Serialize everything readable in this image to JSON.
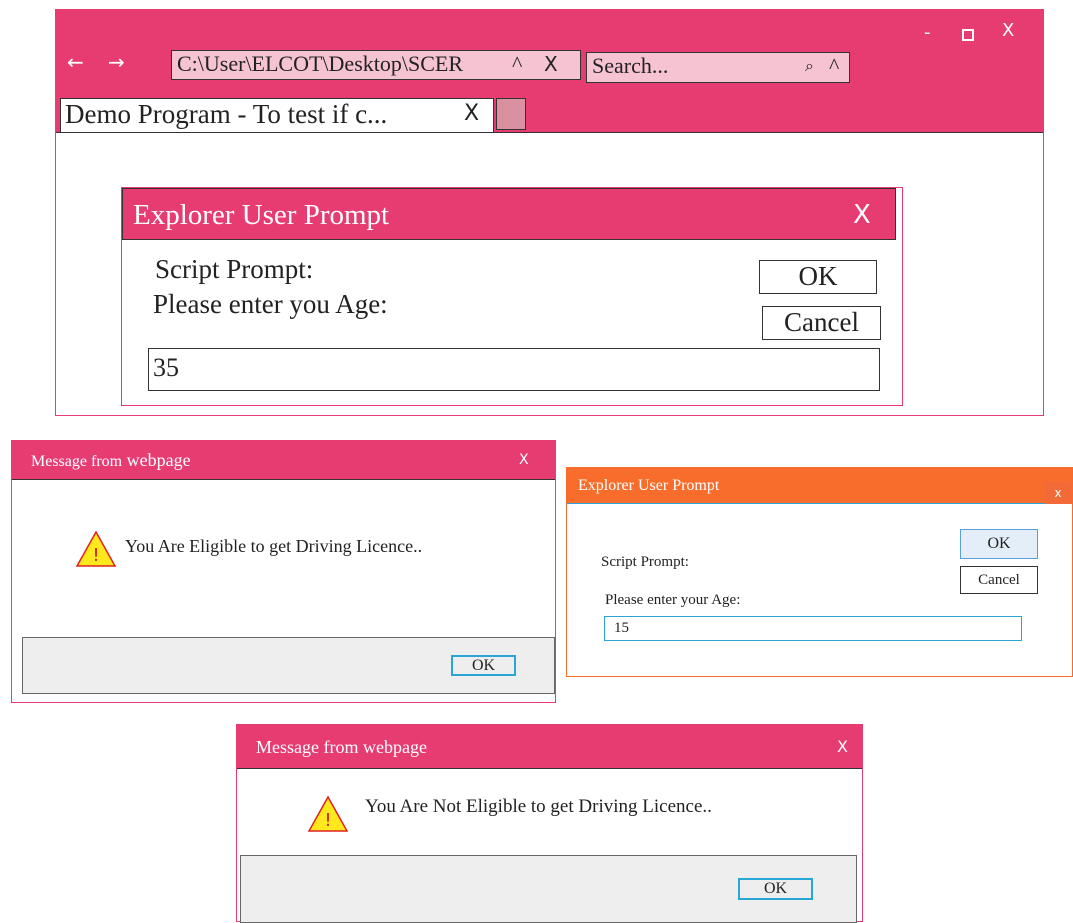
{
  "browser": {
    "window_controls": {
      "minimize": "-",
      "close": "X"
    },
    "nav": {
      "back": "←",
      "forward": "→"
    },
    "address": {
      "value": "C:\\User\\ELCOT\\Desktop\\SCER",
      "dropdown": "^",
      "clear": "X"
    },
    "search": {
      "placeholder": "Search...",
      "icon": "⌕",
      "dropdown": "^"
    },
    "tab": {
      "label": "Demo Program - To test if c...",
      "close": "X"
    },
    "colors": {
      "accent": "#e73c72",
      "address_bg": "#f6c3d3",
      "new_tab": "#d9919f"
    }
  },
  "prompt_main": {
    "title": "Explorer User Prompt",
    "close": "X",
    "script_label": "Script Prompt:",
    "question": "Please enter you Age:",
    "ok": "OK",
    "cancel": "Cancel",
    "value": "35"
  },
  "message_eligible": {
    "title_prefix": "Message from",
    "title_suffix": " webpage",
    "close": "X",
    "icon": "warning-icon",
    "icon_glyph": "!",
    "text": "You Are Eligible to get Driving Licence..",
    "ok": "OK"
  },
  "prompt_second": {
    "title": "Explorer User Prompt",
    "close": "x",
    "script_label": "Script Prompt:",
    "question": "Please enter your Age:",
    "ok": "OK",
    "cancel": "Cancel",
    "value": "15",
    "colors": {
      "title_bg": "#f96d2c",
      "focus": "#29a6d8"
    }
  },
  "message_not_eligible": {
    "title": "Message from webpage",
    "close": "X",
    "icon": "warning-icon",
    "icon_glyph": "!",
    "text": "You Are Not Eligible to get Driving Licence..",
    "ok": "OK"
  }
}
